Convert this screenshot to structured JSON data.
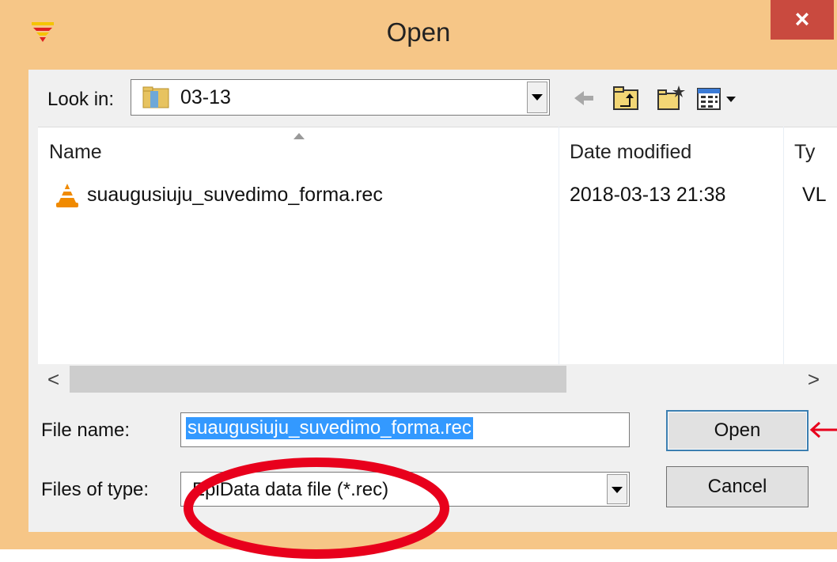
{
  "window": {
    "title": "Open",
    "close_label": "×"
  },
  "lookin": {
    "label": "Look in:",
    "value": "03-13"
  },
  "toolbar": {
    "icons": [
      "back-arrow-icon",
      "up-folder-icon",
      "new-folder-icon",
      "view-menu-icon"
    ]
  },
  "columns": {
    "name": "Name",
    "date": "Date modified",
    "type": "Ty"
  },
  "files": [
    {
      "name": "suaugusiuju_suvedimo_forma.rec",
      "date": "2018-03-13 21:38",
      "type": "VL",
      "icon": "vlc-cone-icon"
    }
  ],
  "form": {
    "filename_label": "File name:",
    "filename_value": "suaugusiuju_suvedimo_forma.rec",
    "filetype_label": "Files of type:",
    "filetype_value": "EpiData data file (*.rec)"
  },
  "buttons": {
    "open": "Open",
    "cancel": "Cancel"
  },
  "scroll": {
    "left_arrow": "<",
    "right_arrow": ">"
  },
  "colors": {
    "frame": "#f6c687",
    "close": "#c94a3f",
    "selection": "#3399ff",
    "annotation": "#e8001c"
  }
}
